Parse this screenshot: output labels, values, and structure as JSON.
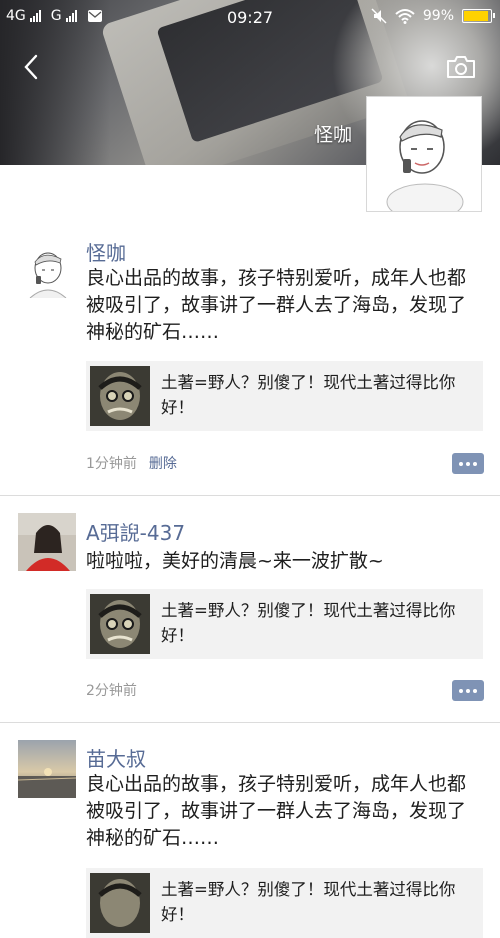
{
  "status_bar": {
    "network1": "4G",
    "network2": "G",
    "time": "09:27",
    "battery": "99%",
    "battery_level": 0.99
  },
  "header": {
    "profile_name": "怪咖",
    "back_icon": "chevron-left-icon",
    "camera_icon": "camera-icon"
  },
  "posts": [
    {
      "name": "怪咖",
      "text": "良心出品的故事，孩子特别爱听，成年人也都被吸引了，故事讲了一群人去了海岛，发现了神秘的矿石……",
      "link_title": "土著=野人？别傻了！现代土著过得比你好！",
      "time": "1分钟前",
      "delete_label": "删除"
    },
    {
      "name": "A弭誽-437",
      "text": "啦啦啦，美好的清晨~来一波扩散~",
      "link_title": "土著=野人？别傻了！现代土著过得比你好！",
      "time": "2分钟前"
    },
    {
      "name": "苗大叔",
      "text": "良心出品的故事，孩子特别爱听，成年人也都被吸引了，故事讲了一群人去了海岛，发现了神秘的矿石……",
      "link_title": "土著=野人？别傻了！现代土著过得比你好！"
    }
  ],
  "colors": {
    "name_link": "#576b95",
    "comment_button": "#7f93b5",
    "meta_text": "#999999",
    "link_card_bg": "#f2f2f2"
  }
}
